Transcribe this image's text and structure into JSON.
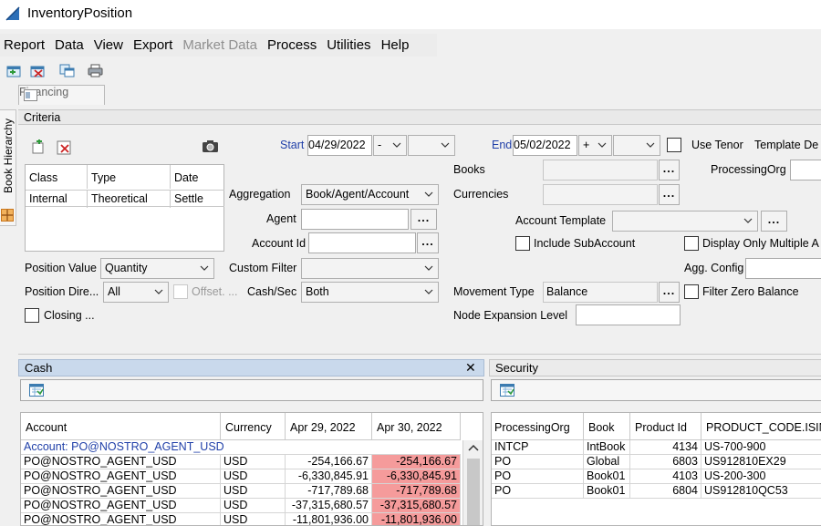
{
  "window": {
    "title": "InventoryPosition"
  },
  "menu": [
    {
      "label": "Report",
      "disabled": false
    },
    {
      "label": "Data",
      "disabled": false
    },
    {
      "label": "View",
      "disabled": false
    },
    {
      "label": "Export",
      "disabled": false
    },
    {
      "label": "Market Data",
      "disabled": true
    },
    {
      "label": "Process",
      "disabled": false
    },
    {
      "label": "Utilities",
      "disabled": false
    },
    {
      "label": "Help",
      "disabled": false
    }
  ],
  "toolbar": {
    "icons": [
      "new-report-icon",
      "delete-report-icon",
      "copy-icon",
      "print-icon"
    ]
  },
  "tabs": {
    "financing": "Financing"
  },
  "sidebar": {
    "book_hierarchy": "Book Hierarchy"
  },
  "criteria": {
    "header": "Criteria",
    "grid": {
      "headers": [
        "Class",
        "Type",
        "Date"
      ],
      "rows": [
        [
          "Internal",
          "Theoretical",
          "Settle"
        ]
      ]
    },
    "start_label": "Start",
    "start_value": "04/29/2022",
    "start_offset": "-",
    "end_label": "End",
    "end_value": "05/02/2022",
    "end_offset": "+",
    "use_tenor": "Use Tenor",
    "template_label": "Template De",
    "books_label": "Books",
    "processing_org_label": "ProcessingOrg",
    "currencies_label": "Currencies",
    "aggregation_label": "Aggregation",
    "aggregation_value": "Book/Agent/Account",
    "agent_label": "Agent",
    "account_id_label": "Account Id",
    "account_template_label": "Account Template",
    "include_subaccount": "Include SubAccount",
    "display_only_multiple": "Display Only Multiple A",
    "position_value_label": "Position Value",
    "position_value": "Quantity",
    "custom_filter_label": "Custom Filter",
    "agg_config_label": "Agg. Config",
    "position_dir_label": "Position Dire...",
    "position_dir_value": "All",
    "offset_label": "Offset. ...",
    "cash_sec_label": "Cash/Sec",
    "cash_sec_value": "Both",
    "movement_type_label": "Movement Type",
    "movement_type_value": "Balance",
    "filter_zero_balance": "Filter Zero Balance",
    "closing_label": "Closing ...",
    "node_expansion_label": "Node Expansion Level",
    "ellipsis": "..."
  },
  "cash": {
    "title": "Cash",
    "close": "✕",
    "headers": [
      "Account",
      "Currency",
      "Apr 29, 2022",
      "Apr 30, 2022"
    ],
    "group_label": "Account: PO@NOSTRO_AGENT_USD",
    "rows": [
      [
        "PO@NOSTRO_AGENT_USD",
        "USD",
        "-254,166.67",
        "-254,166.67"
      ],
      [
        "PO@NOSTRO_AGENT_USD",
        "USD",
        "-6,330,845.91",
        "-6,330,845.91"
      ],
      [
        "PO@NOSTRO_AGENT_USD",
        "USD",
        "-717,789.68",
        "-717,789.68"
      ],
      [
        "PO@NOSTRO_AGENT_USD",
        "USD",
        "-37,315,680.57",
        "-37,315,680.57"
      ],
      [
        "PO@NOSTRO_AGENT_USD",
        "USD",
        "-11,801,936.00",
        "-11,801,936.00"
      ]
    ],
    "negative_color": "#f59b9b"
  },
  "security": {
    "title": "Security",
    "headers": [
      "ProcessingOrg",
      "Book",
      "Product Id",
      "PRODUCT_CODE.ISIN"
    ],
    "rows": [
      [
        "INTCP",
        "IntBook",
        "4134",
        "US-700-900"
      ],
      [
        "PO",
        "Global",
        "6803",
        "US912810EX29"
      ],
      [
        "PO",
        "Book01",
        "4103",
        "US-200-300"
      ],
      [
        "PO",
        "Book01",
        "6804",
        "US912810QC53"
      ]
    ]
  }
}
